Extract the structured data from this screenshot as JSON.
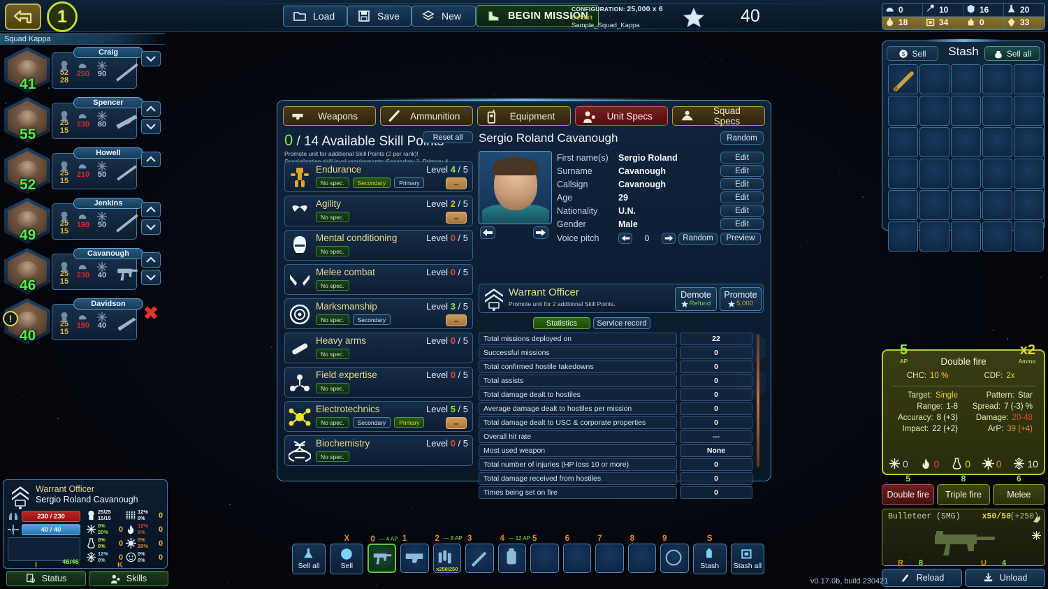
{
  "topbar": {
    "back_icon": "back-arrow-icon",
    "turn_number": "1",
    "buttons": [
      {
        "label": "Load",
        "icon": "folder-icon"
      },
      {
        "label": "Save",
        "icon": "floppy-disk-icon"
      },
      {
        "label": "New",
        "icon": "layers-icon"
      }
    ],
    "begin_mission": "BEGIN MISSION",
    "config_label": "CONFIGURATION:",
    "config_value": "25,000 x 6",
    "config_preset": "Default",
    "config_file": "Sample_Squad_Kappa",
    "credits": "40",
    "star_icon": "star-icon"
  },
  "resources": [
    {
      "icon": "helmet-icon",
      "value": "0"
    },
    {
      "icon": "wrench-icon",
      "value": "10"
    },
    {
      "icon": "shield-icon",
      "value": "16"
    },
    {
      "icon": "flask-icon",
      "value": "20"
    },
    {
      "icon": "grenade-icon",
      "value": "18"
    },
    {
      "icon": "crate-icon",
      "value": "34"
    },
    {
      "icon": "canister-icon",
      "value": "0"
    },
    {
      "icon": "crystal-icon",
      "value": "33"
    }
  ],
  "squad": {
    "header": "Squad Kappa",
    "members": [
      {
        "name": "Craig",
        "level": "41",
        "armor": "52",
        "armor2": "28",
        "hp": "250",
        "ap": "90",
        "weapon_icon": "sniper-rifle-icon",
        "alert": false
      },
      {
        "name": "Spencer",
        "level": "55",
        "armor": "25",
        "armor2": "15",
        "hp": "230",
        "ap": "80",
        "weapon_icon": "rifle-icon",
        "alert": false
      },
      {
        "name": "Howell",
        "level": "52",
        "armor": "25",
        "armor2": "15",
        "hp": "210",
        "ap": "50",
        "weapon_icon": "shotgun-icon",
        "alert": false
      },
      {
        "name": "Jenkins",
        "level": "49",
        "armor": "25",
        "armor2": "15",
        "hp": "190",
        "ap": "50",
        "weapon_icon": "sniper-rifle-icon",
        "alert": false
      },
      {
        "name": "Cavanough",
        "level": "46",
        "armor": "25",
        "armor2": "15",
        "hp": "230",
        "ap": "40",
        "weapon_icon": "smg-icon",
        "alert": false
      },
      {
        "name": "Davidson",
        "level": "40",
        "armor": "25",
        "armor2": "15",
        "hp": "150",
        "ap": "40",
        "weapon_icon": "carbine-icon",
        "alert": true
      }
    ]
  },
  "center": {
    "tabs": [
      {
        "label": "Weapons",
        "icon": "pistol-icon",
        "active": false
      },
      {
        "label": "Ammunition",
        "icon": "bullet-icon",
        "active": false
      },
      {
        "label": "Equipment",
        "icon": "radio-icon",
        "active": false
      },
      {
        "label": "Unit Specs",
        "icon": "person-icon",
        "active": true
      },
      {
        "label": "Squad Specs",
        "icon": "squad-icon",
        "active": false
      }
    ],
    "skill_points": {
      "current": "0",
      "total_text": "/ 14 Available Skill Points",
      "hint_line1_a": "Promote unit for additional Skill Points (",
      "hint_line1_b": "2",
      "hint_line1_c": " per rank)!",
      "hint_line2_a": "Specialization skill level requirements: Secondary ",
      "hint_line2_b": "3",
      "hint_line2_c": ", Primary ",
      "hint_line2_d": "4",
      "reset_all": "Reset all"
    },
    "skills": [
      {
        "name": "Endurance",
        "icon": "mech-suit-icon",
        "level": "4",
        "max": "5",
        "tags": [
          "No spec.",
          "Secondary",
          "Primary"
        ],
        "selected": "Secondary",
        "has_minus": true
      },
      {
        "name": "Agility",
        "icon": "infinity-icon",
        "level": "2",
        "max": "5",
        "tags": [
          "No spec."
        ],
        "selected": "No spec.",
        "has_minus": true
      },
      {
        "name": "Mental conditioning",
        "icon": "head-icon",
        "level": "0",
        "max": "5",
        "tags": [
          "No spec."
        ],
        "selected": "No spec.",
        "has_minus": false
      },
      {
        "name": "Melee combat",
        "icon": "knives-icon",
        "level": "0",
        "max": "5",
        "tags": [
          "No spec."
        ],
        "selected": "No spec.",
        "has_minus": false
      },
      {
        "name": "Marksmanship",
        "icon": "crosshair-icon",
        "level": "3",
        "max": "5",
        "tags": [
          "No spec.",
          "Secondary"
        ],
        "selected": "No spec.",
        "has_minus": true
      },
      {
        "name": "Heavy arms",
        "icon": "launcher-icon",
        "level": "0",
        "max": "5",
        "tags": [
          "No spec."
        ],
        "selected": "No spec.",
        "has_minus": false
      },
      {
        "name": "Field expertise",
        "icon": "molecule-icon",
        "level": "0",
        "max": "5",
        "tags": [
          "No spec."
        ],
        "selected": "No spec.",
        "has_minus": false
      },
      {
        "name": "Electrotechnics",
        "icon": "circuit-icon",
        "level": "5",
        "max": "5",
        "tags": [
          "No spec.",
          "Secondary",
          "Primary"
        ],
        "selected": "Primary",
        "has_minus": true
      },
      {
        "name": "Biochemistry",
        "icon": "dna-icon",
        "level": "0",
        "max": "5",
        "tags": [
          "No spec."
        ],
        "selected": "No spec.",
        "has_minus": false
      }
    ],
    "unit": {
      "full_name": "Sergio Roland Cavanough",
      "random_button": "Random",
      "fields": [
        {
          "label": "First name(s)",
          "value": "Sergio Roland",
          "button": "Edit"
        },
        {
          "label": "Surname",
          "value": "Cavanough",
          "button": "Edit"
        },
        {
          "label": "Callsign",
          "value": "Cavanough",
          "button": "Edit"
        },
        {
          "label": "Age",
          "value": "29",
          "button": "Edit"
        },
        {
          "label": "Nationality",
          "value": "U.N.",
          "button": "Edit"
        },
        {
          "label": "Gender",
          "value": "Male",
          "button": "Edit"
        }
      ],
      "voice_pitch_label": "Voice pitch",
      "voice_pitch_value": "0",
      "voice_random": "Random",
      "voice_preview": "Preview"
    },
    "rank": {
      "name": "Warrant Officer",
      "sub_a": "Promote unit for ",
      "sub_b": "2",
      "sub_c": " additional Skill Points.",
      "demote_label": "Demote",
      "demote_value": "Refund",
      "promote_label": "Promote",
      "promote_value": "5,000"
    },
    "stat_tabs": [
      {
        "label": "Statistics",
        "active": true
      },
      {
        "label": "Service record",
        "active": false
      }
    ],
    "statistics": [
      {
        "key": "Total missions deployed on",
        "value": "22"
      },
      {
        "key": "Successful missions",
        "value": "0"
      },
      {
        "key": "Total confirmed hostile takedowns",
        "value": "0"
      },
      {
        "key": "Total assists",
        "value": "0"
      },
      {
        "key": "Total damage dealt to hostiles",
        "value": "0"
      },
      {
        "key": "Average damage dealt to hostiles per mission",
        "value": "0"
      },
      {
        "key": "Total damage dealt to USC & corporate properties",
        "value": "0"
      },
      {
        "key": "Overall hit rate",
        "value": "---"
      },
      {
        "key": "Most used weapon",
        "value": "None"
      },
      {
        "key": "Total number of injuries (HP loss 10 or more)",
        "value": "0"
      },
      {
        "key": "Total damage received from hostiles",
        "value": "0"
      },
      {
        "key": "Times being set on fire",
        "value": "0"
      }
    ]
  },
  "stash": {
    "title": "Stash",
    "sell": "Sell",
    "sell_all": "Sell all",
    "rows": 6,
    "cols": 5,
    "items": [
      {
        "slot": 0,
        "icon": "knife-icon"
      }
    ]
  },
  "weapon_stats": {
    "ap_value": "5",
    "ap_label": "AP",
    "ammo_value": "x2",
    "ammo_label": "Ammo",
    "mode_name": "Double fire",
    "chc_label": "CHC:",
    "chc_value": "10 %",
    "cdf_label": "CDF:",
    "cdf_value": "2x",
    "rows": [
      {
        "label": "Target:",
        "value": "Single",
        "style": "vb"
      },
      {
        "label": "Pattern:",
        "value": "Star",
        "style": "vwh"
      },
      {
        "label": "Range:",
        "value": "1-8",
        "style": "vwh"
      },
      {
        "label": "Spread:",
        "value": "7 (-3) %",
        "style": "vwh"
      },
      {
        "label": "Accuracy:",
        "value": "8 (+3)",
        "style": "vwh"
      },
      {
        "label": "Damage:",
        "value": "20-48",
        "style": "vred"
      },
      {
        "label": "Impact:",
        "value": "22 (+2)",
        "style": "vwh"
      },
      {
        "label": "ArP:",
        "value": "39 (+4)",
        "style": "vor"
      }
    ],
    "elements": [
      {
        "icon": "energy-icon",
        "value": "0",
        "color": "#c8cde8"
      },
      {
        "icon": "fire-icon",
        "value": "0",
        "color": "#e2472f"
      },
      {
        "icon": "acid-icon",
        "value": "0",
        "color": "#c7e23c"
      },
      {
        "icon": "bio-icon",
        "value": "0",
        "color": "#e08c2a"
      },
      {
        "icon": "frost-icon",
        "value": "10",
        "color": "#eef2dc"
      }
    ]
  },
  "fire_modes": [
    {
      "label": "Double fire",
      "cost": "5",
      "active": true
    },
    {
      "label": "Triple fire",
      "cost": "8",
      "active": false
    },
    {
      "label": "Melee",
      "cost": "6",
      "active": false
    }
  ],
  "equipped_weapon": {
    "name": "Bulleteer  (SMG)",
    "ammo": "x50/50",
    "ammo_bonus": "(+250)",
    "icon": "smg-icon",
    "side_icons": [
      "impact-icon",
      "frost-icon"
    ]
  },
  "weapon_buttons": [
    {
      "label": "Reload",
      "hotkey": "R",
      "cost": "8",
      "icon": "reload-icon"
    },
    {
      "label": "Unload",
      "hotkey": "U",
      "cost": "4",
      "icon": "unload-icon"
    }
  ],
  "status_panel": {
    "rank": "Warrant Officer",
    "name": "Sergio Roland Cavanough",
    "hp_bar": "230 / 230",
    "ap_bar": "40 / 40",
    "armor_value": "46/46",
    "resist_grid": [
      {
        "icon": "armor-icon",
        "p1": "25/25",
        "p2": "15/15",
        "p1c": "#eef6fd",
        "p2c": "#eef6fd",
        "z": "",
        "icon2": "kinetic-icon",
        "q1": "12%",
        "q2": "0%",
        "q1c": "#eef6fd",
        "q2c": "#eef6fd",
        "z2": "0"
      },
      {
        "icon": "energy-icon",
        "p1": "0%",
        "p2": "20%",
        "p1c": "#8de83c",
        "p2c": "#8de83c",
        "z": "0",
        "icon2": "fire-icon",
        "q1": "12%",
        "q2": "0%",
        "q1c": "#e2472f",
        "q2c": "#e2472f",
        "z2": "0"
      },
      {
        "icon": "acid-icon",
        "p1": "0%",
        "p2": "0%",
        "p1c": "#c7e23c",
        "p2c": "#c7e23c",
        "z": "0",
        "icon2": "bio-icon",
        "q1": "0%",
        "q2": "20%",
        "q1c": "#e08c2a",
        "q2c": "#e08c2a",
        "z2": "0"
      },
      {
        "icon": "frost-icon",
        "p1": "12%",
        "p2": "0%",
        "p1c": "#9fd8f5",
        "p2c": "#9fd8f5",
        "z": "0",
        "icon2": "toxin-icon",
        "q1": "0%",
        "q2": "0%",
        "q1c": "#cfe0ee",
        "q2c": "#cfe0ee",
        "z2": "0"
      }
    ],
    "buttons": [
      {
        "label": "Status",
        "hotkey": "I",
        "icon": "document-icon"
      },
      {
        "label": "Skills",
        "hotkey": "K",
        "icon": "person-icon"
      }
    ]
  },
  "inventory": {
    "sell_all": "Sell all",
    "sell": "Sell",
    "sell_hotkey": "X",
    "stash": "Stash",
    "stash_all": "Stash all",
    "stash_hotkey": "S",
    "slots": [
      {
        "num": "0",
        "ap": "— 4 AP",
        "icon": "smg-icon",
        "selected": true,
        "count": ""
      },
      {
        "num": "1",
        "ap": "",
        "icon": "pistol-icon",
        "selected": false,
        "count": ""
      },
      {
        "num": "2",
        "ap": "— 8 AP",
        "icon": "ammo-icon",
        "selected": false,
        "count": "x250/250"
      },
      {
        "num": "3",
        "ap": "",
        "icon": "blade-icon",
        "selected": false,
        "count": ""
      },
      {
        "num": "4",
        "ap": "— 12 AP",
        "icon": "gear-pack-icon",
        "selected": false,
        "count": ""
      },
      {
        "num": "5",
        "ap": "",
        "icon": "",
        "selected": false,
        "count": ""
      },
      {
        "num": "6",
        "ap": "",
        "icon": "",
        "selected": false,
        "count": ""
      },
      {
        "num": "7",
        "ap": "",
        "icon": "",
        "selected": false,
        "count": ""
      },
      {
        "num": "8",
        "ap": "",
        "icon": "",
        "selected": false,
        "count": ""
      },
      {
        "num": "9",
        "ap": "",
        "icon": "ring-icon",
        "selected": false,
        "count": ""
      }
    ]
  },
  "version": "v0.17.0b, build 230421",
  "colors": {
    "accent_blue": "#4e8fbb",
    "green": "#8de83c",
    "gold": "#e9d98f",
    "red": "#e2472f",
    "panel_bg": "#112339"
  }
}
